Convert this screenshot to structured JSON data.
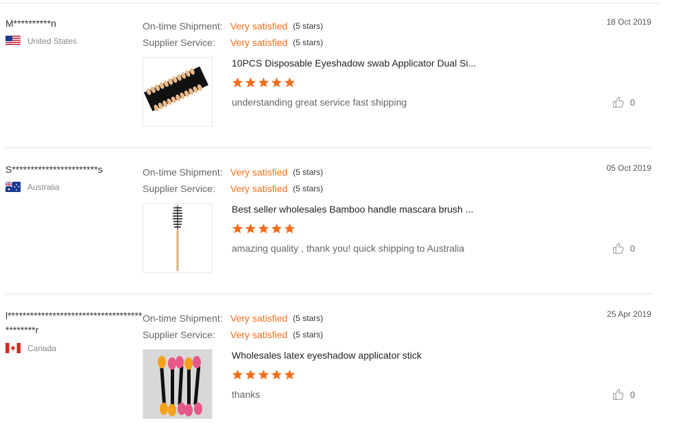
{
  "labels": {
    "ontime": "On-time Shipment:",
    "supplier": "Supplier Service:"
  },
  "reviews": [
    {
      "user": "M**********n",
      "country": "United States",
      "flag": "us-flag",
      "ontime_value": "Very satisfied",
      "ontime_stars": "(5 stars)",
      "supplier_value": "Very satisfied",
      "supplier_stars": "(5 stars)",
      "date": "18 Oct 2019",
      "product": "10PCS Disposable Eyeshadow swab Applicator Dual Si...",
      "product_image": "eyeshadow-applicators-pile",
      "rating": 5,
      "comment": "understanding great service fast shipping",
      "likes": "0"
    },
    {
      "user": "S***********************s",
      "country": "Australia",
      "flag": "au-flag",
      "ontime_value": "Very satisfied",
      "ontime_stars": "(5 stars)",
      "supplier_value": "Very satisfied",
      "supplier_stars": "(5 stars)",
      "date": "05 Oct 2019",
      "product": "Best seller wholesales Bamboo handle mascara brush ...",
      "product_image": "bamboo-mascara-brush",
      "rating": 5,
      "comment": "amazing quality , thank you! quick shipping to Australia",
      "likes": "0"
    },
    {
      "user": "l********************************************r",
      "country": "Canada",
      "flag": "ca-flag",
      "ontime_value": "Very satisfied",
      "ontime_stars": "(5 stars)",
      "supplier_value": "Very satisfied",
      "supplier_stars": "(5 stars)",
      "date": "25 Apr 2019",
      "product": "Wholesales latex eyeshadow applicator stick",
      "product_image": "latex-applicator-sticks",
      "rating": 5,
      "comment": "thanks",
      "likes": "0"
    }
  ],
  "colors": {
    "accent": "#f56e1a",
    "star": "#f56e1a"
  }
}
